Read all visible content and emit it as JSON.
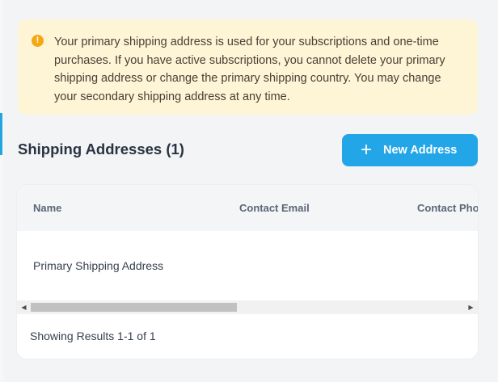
{
  "notice": {
    "icon": "info-icon",
    "icon_glyph": "!",
    "text": "Your primary shipping address is used for your subscriptions and one-time purchases. If you have active subscriptions, you cannot delete your primary shipping address or change the primary shipping country. You may change your secondary shipping address at any time."
  },
  "section": {
    "title": "Shipping Addresses (1)"
  },
  "new_address_button": {
    "icon": "plus-icon",
    "icon_glyph": "+",
    "label": "New Address"
  },
  "table": {
    "columns": [
      "Name",
      "Contact Email",
      "Contact Pho"
    ],
    "rows": [
      [
        "Primary Shipping Address",
        "",
        ""
      ]
    ]
  },
  "footer": {
    "results_text": "Showing Results 1-1 of 1"
  },
  "colors": {
    "notice_bg": "#fef4d6",
    "info_icon": "#f5a714",
    "primary_button": "#22a6e8",
    "accent": "#22a6df"
  }
}
